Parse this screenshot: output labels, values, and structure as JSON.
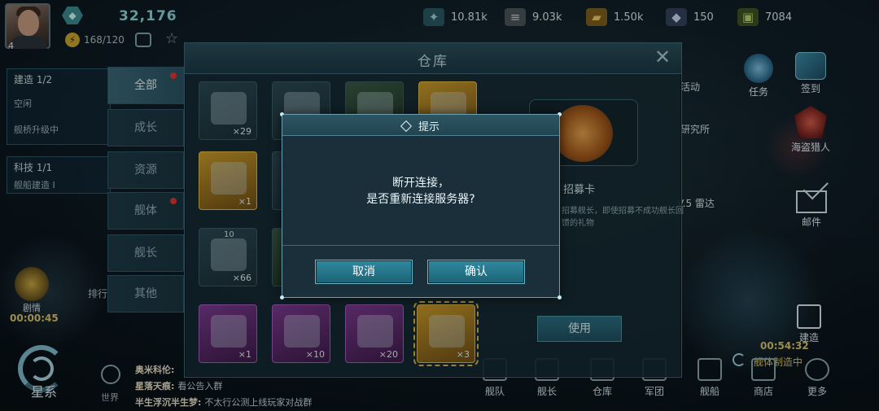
{
  "player": {
    "level": "4",
    "power": "32,176",
    "energy": "168/120"
  },
  "resources": [
    {
      "icon": "crystal-icon",
      "value": "10.81k",
      "color": "#6fb0c0"
    },
    {
      "icon": "alloy-icon",
      "value": "9.03k",
      "color": "#8e9aa0"
    },
    {
      "icon": "gold-bar-icon",
      "value": "1.50k",
      "color": "#c99b35"
    },
    {
      "icon": "gem-icon",
      "value": "150",
      "color": "#9fb6d0"
    },
    {
      "icon": "credit-icon",
      "value": "7084",
      "color": "#6d8d3a"
    }
  ],
  "left_panel": {
    "build_title": "建造 1/2",
    "build_rows": [
      "空闲",
      "舰桥升级中"
    ],
    "tech_title": "科技 1/1",
    "tech_row": "舰船建造 I",
    "timer_label": "剧情",
    "timer": "00:00:45",
    "rank_label": "排行榜",
    "galaxy_label": "星系",
    "world_label": "世界"
  },
  "chat": [
    {
      "name": "奥米科伦:",
      "text": ""
    },
    {
      "name": "星落天痕:",
      "text": "看公告入群"
    },
    {
      "name": "半生浮沉半生梦:",
      "text": "不太行公测上线玩家对战群"
    }
  ],
  "right_hud": {
    "activity": "活动",
    "task": "任务",
    "signin": "签到",
    "lab": "研究所",
    "pirate": "海盗猎人",
    "radar": "V.5 雷达",
    "mail": "邮件",
    "build": "建造",
    "timer": "00:54:32",
    "timer_status": "舰体制造中"
  },
  "bottom_nav": [
    "舰队",
    "舰长",
    "仓库",
    "军团",
    "舰船",
    "商店",
    "更多"
  ],
  "warehouse": {
    "title": "仓库",
    "tabs": [
      "全部",
      "成长",
      "资源",
      "舰体",
      "舰长",
      "其他"
    ],
    "items": [
      {
        "count": "×29",
        "kind": "normal"
      },
      {
        "count": "",
        "kind": "normal"
      },
      {
        "count": "",
        "kind": "green"
      },
      {
        "count": "",
        "kind": "gold"
      },
      {
        "count": "×1",
        "kind": "gold"
      },
      {
        "count": "",
        "kind": "normal"
      },
      {
        "count": "×66",
        "kind": "normal"
      },
      {
        "count": "",
        "kind": "green"
      },
      {
        "count": "×1",
        "kind": "purple"
      },
      {
        "count": "×10",
        "kind": "purple"
      },
      {
        "count": "×20",
        "kind": "purple"
      },
      {
        "count": "×3",
        "kind": "gold"
      }
    ],
    "stack_label": "10",
    "detail_name": "招募卡",
    "detail_desc": "招募舰长，即使招募不成功舰长回馈的礼物",
    "use_label": "使用"
  },
  "dialog": {
    "title": "提示",
    "message_line1": "断开连接，",
    "message_line2": "是否重新连接服务器?",
    "cancel_label": "取消",
    "confirm_label": "确认"
  }
}
